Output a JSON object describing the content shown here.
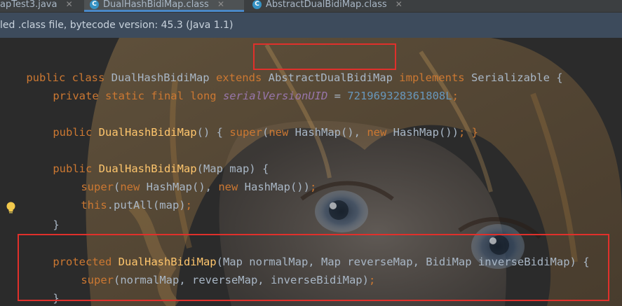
{
  "tabs": [
    {
      "label": "apTest3.java",
      "active": false
    },
    {
      "label": "DualHashBidiMap.class",
      "active": true,
      "icon": "C"
    },
    {
      "label": "AbstractDualBidiMap.class",
      "active": false,
      "icon": "C"
    }
  ],
  "banner": {
    "text": "led .class file, bytecode version: 45.3 (Java 1.1)"
  },
  "code": {
    "l1": {
      "kw1": "public class ",
      "name": "DualHashBidiMap",
      "kw2": " extends ",
      "parent": "AbstractDualBidiMap",
      "kw3": " implements ",
      "iface": "Serializable {"
    },
    "l2": {
      "mods": "private static final long ",
      "field": "serialVersionUID",
      "eq": " = ",
      "num": "721969328361808L",
      "semi": ";"
    },
    "l3": {
      "kw": "public ",
      "fn": "DualHashBidiMap",
      "a": "() { ",
      "kw2": "super",
      "b": "(",
      "kw3": "new ",
      "c": "HashMap(), ",
      "kw4": "new ",
      "d": "HashMap())",
      "e": "; }"
    },
    "l4": {
      "kw": "public ",
      "fn": "DualHashBidiMap",
      "a": "(Map map) {"
    },
    "l5": {
      "kw": "super",
      "a": "(",
      "kw2": "new ",
      "b": "HashMap(), ",
      "kw3": "new ",
      "c": "HashMap())",
      "d": ";"
    },
    "l6": {
      "kw": "this",
      "a": ".putAll(map)",
      "b": ";"
    },
    "l7": {
      "a": "}"
    },
    "l8": {
      "kw": "protected ",
      "fn": "DualHashBidiMap",
      "a": "(Map normalMap, Map reverseMap, BidiMap inverseBidiMap) {"
    },
    "l9": {
      "kw": "super",
      "a": "(normalMap, reverseMap, inverseBidiMap)",
      "b": ";"
    },
    "l10": {
      "a": "}"
    }
  },
  "colors": {
    "keyword": "#cc7832",
    "function": "#ffc66d",
    "field": "#9876aa",
    "number": "#6897bb",
    "highlight_box": "#e0302b"
  },
  "icons": {
    "bulb": "lightbulb-icon",
    "class_icon": "class-file-icon"
  }
}
